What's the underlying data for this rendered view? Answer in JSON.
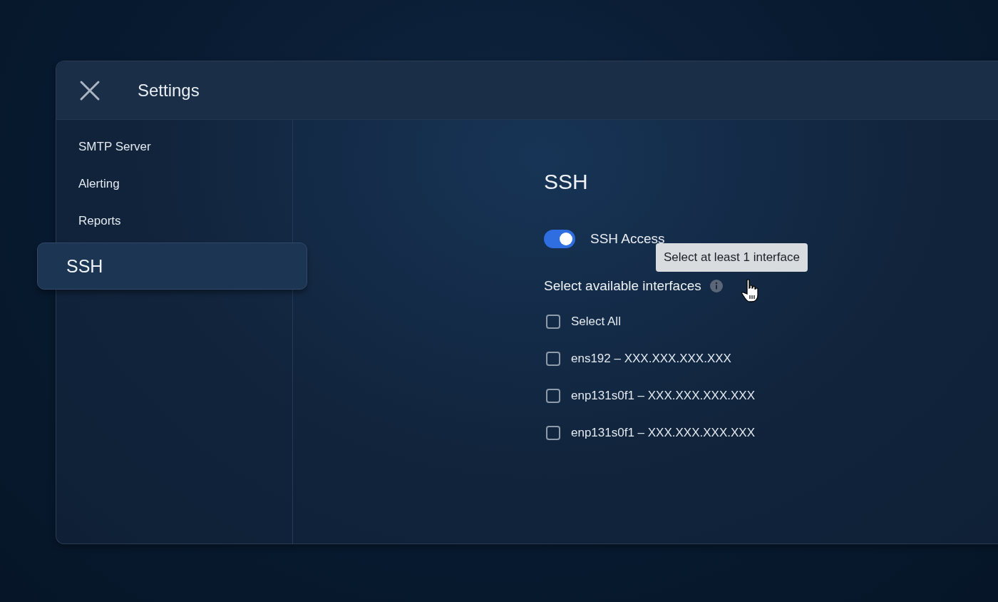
{
  "window": {
    "title": "Settings"
  },
  "sidebar": {
    "items": [
      {
        "label": "SMTP Server",
        "selected": false
      },
      {
        "label": "Alerting",
        "selected": false
      },
      {
        "label": "Reports",
        "selected": false
      },
      {
        "label": "SSH",
        "selected": true
      }
    ]
  },
  "section": {
    "title": "SSH",
    "toggle": {
      "label": "SSH Access",
      "on": true
    },
    "tooltip": "Select at least 1 interface",
    "interfaces_heading": "Select available interfaces",
    "interfaces": [
      {
        "label": "Select All",
        "checked": false
      },
      {
        "label": "ens192 – XXX.XXX.XXX.XXX",
        "checked": false
      },
      {
        "label": "enp131s0f1 – XXX.XXX.XXX.XXX",
        "checked": false
      },
      {
        "label": "enp131s0f1 – XXX.XXX.XXX.XXX",
        "checked": false
      }
    ]
  }
}
